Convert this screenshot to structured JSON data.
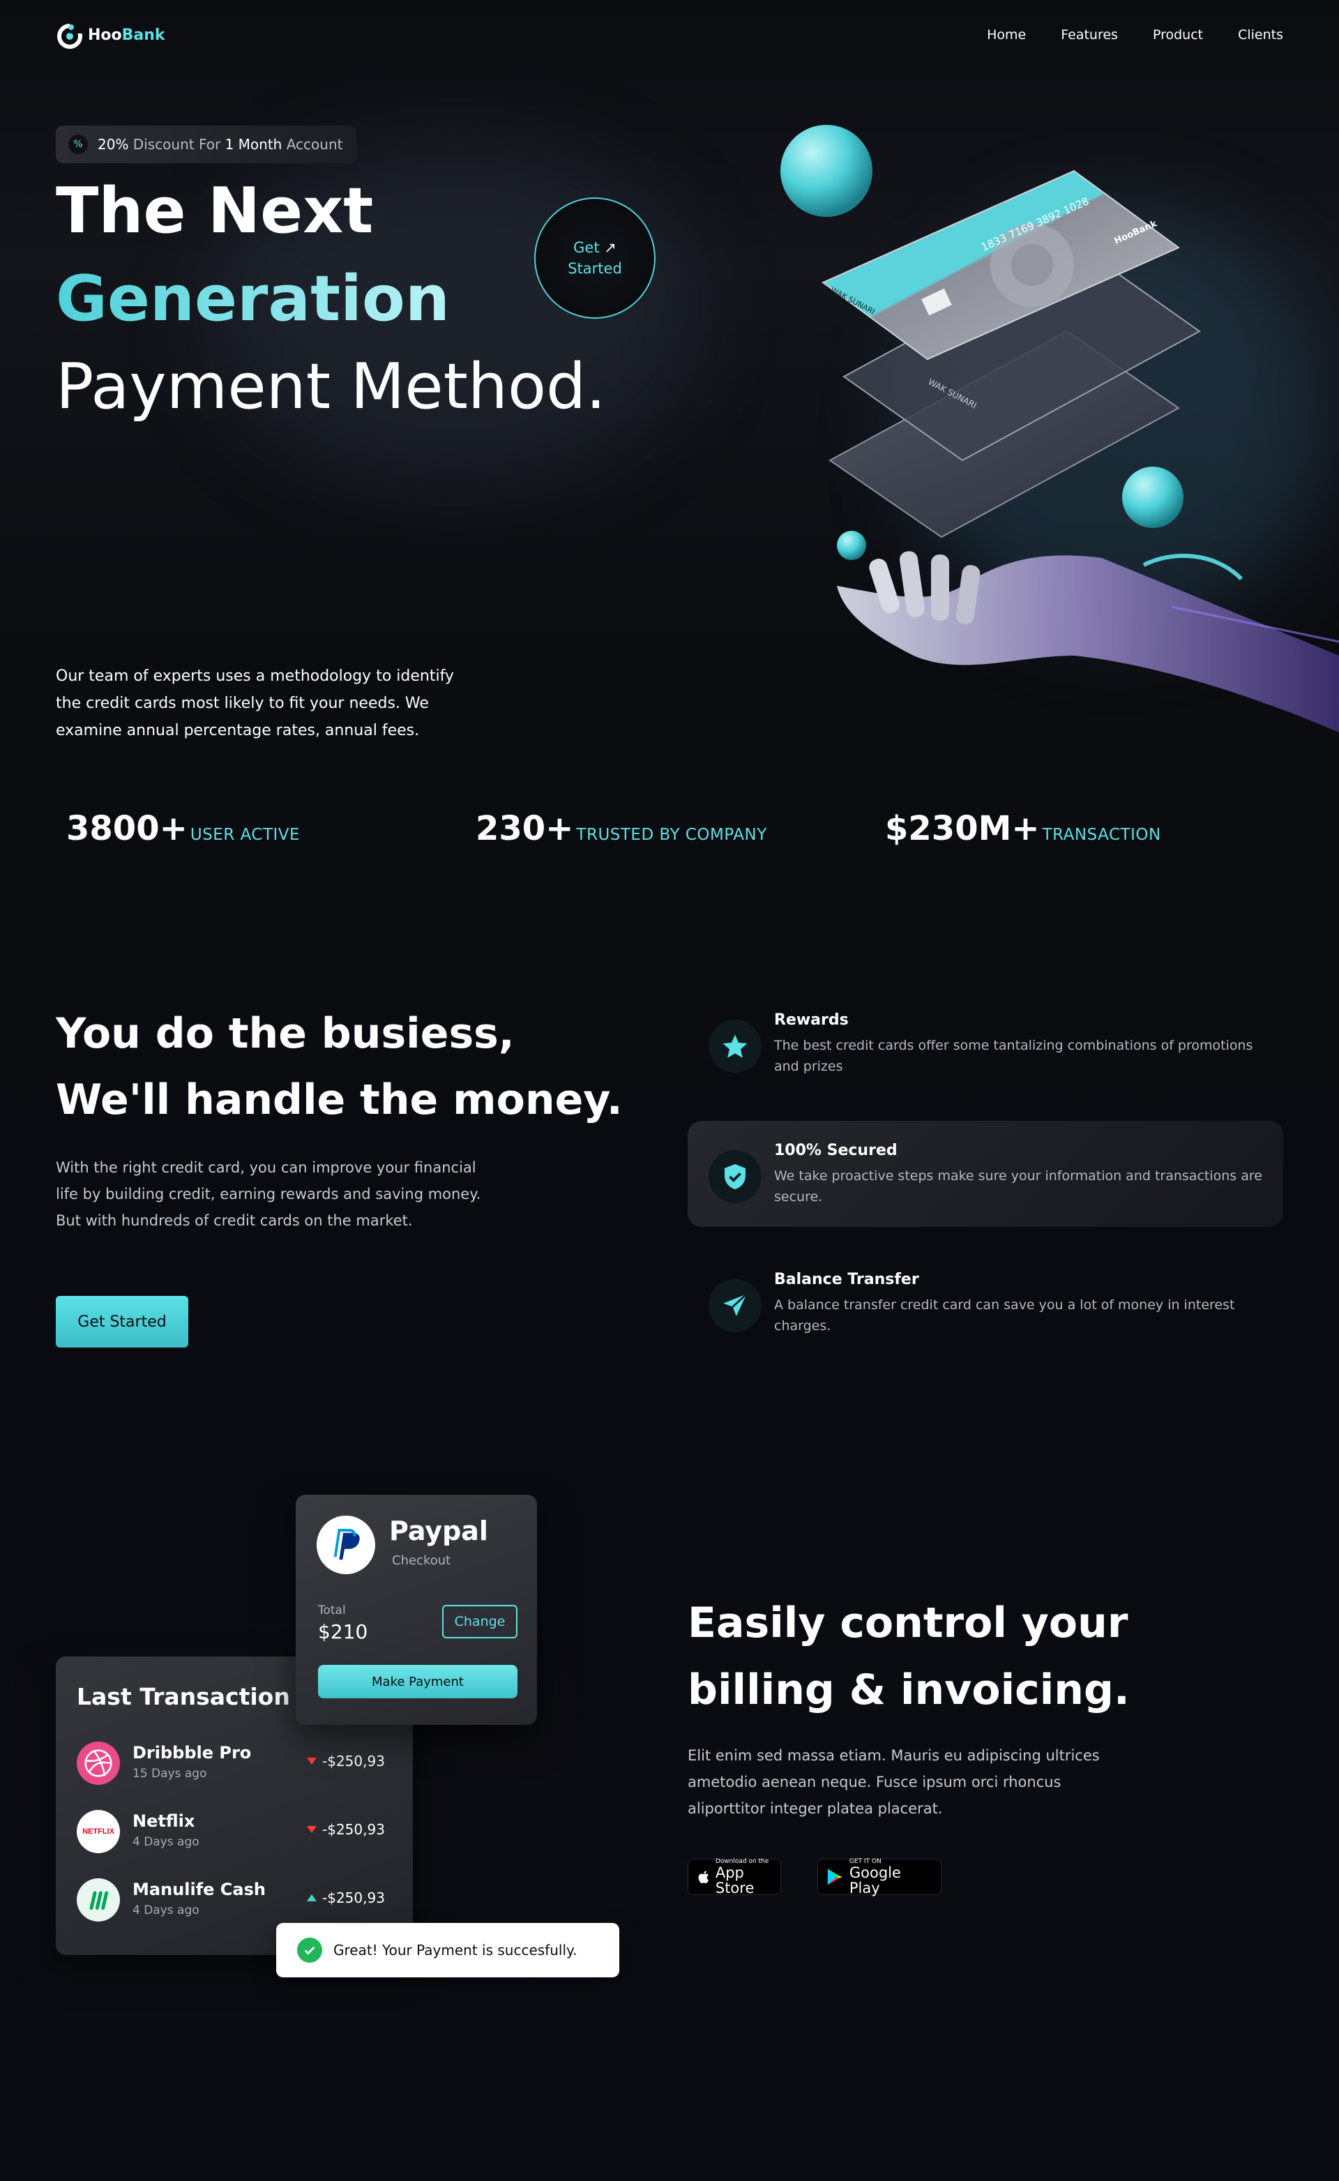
{
  "brand": {
    "name_part1": "Hoo",
    "name_part2": "Bank",
    "accent": "#5ce1e6"
  },
  "nav": {
    "items": [
      "Home",
      "Features",
      "Product",
      "Clients"
    ]
  },
  "hero": {
    "badge_icon": "percent-icon",
    "badge_pre": "20%",
    "badge_mid": " Discount For ",
    "badge_bold": "1 Month",
    "badge_post": " Account",
    "title_line1": "The Next",
    "title_line2": "Generation",
    "title_line3": "Payment Method.",
    "cta_line1": "Get",
    "cta_line2": "Started",
    "description": "Our team of experts uses a methodology to identify the credit cards most likely to fit your needs. We examine annual percentage rates, annual fees."
  },
  "card_art": {
    "number": "1833 7169 3892 1028",
    "holder": "WAK SUNARI",
    "brand": "HooBank"
  },
  "stats": [
    {
      "value": "3800+",
      "label": "USER ACTIVE"
    },
    {
      "value": "230+",
      "label": "TRUSTED BY COMPANY"
    },
    {
      "value": "$230M+",
      "label": "TRANSACTION"
    }
  ],
  "business": {
    "title_line1": "You do the busiess,",
    "title_line2": "We'll handle the money.",
    "description": "With the right credit card, you can improve your financial life by building credit, earning rewards and saving money. But with hundreds of credit cards on the market.",
    "cta": "Get Started",
    "features": [
      {
        "icon": "star-icon",
        "title": "Rewards",
        "text": "The best credit cards offer some tantalizing combinations of promotions and prizes"
      },
      {
        "icon": "shield-icon",
        "title": "100% Secured",
        "text": "We take proactive steps make sure your information and transactions are secure."
      },
      {
        "icon": "send-icon",
        "title": "Balance Transfer",
        "text": "A balance transfer credit card can save you a lot of money in interest charges."
      }
    ]
  },
  "billing": {
    "title_line1": "Easily control your",
    "title_line2": "billing & invoicing.",
    "description": "Elit enim sed massa etiam. Mauris eu adipiscing ultrices ametodio aenean neque. Fusce ipsum orci rhoncus aliporttitor integer platea placerat.",
    "stores": [
      {
        "icon": "apple-icon",
        "small": "Download on the",
        "big": "App Store"
      },
      {
        "icon": "google-play-icon",
        "small": "GET IT ON",
        "big": "Google Play"
      }
    ]
  },
  "paypal": {
    "name": "Paypal",
    "subtitle": "Checkout",
    "total_label": "Total",
    "total_value": "$210",
    "change": "Change",
    "pay": "Make Payment"
  },
  "last_transaction": {
    "title": "Last Transaction",
    "items": [
      {
        "name": "Dribbble Pro",
        "date": "15 Days ago",
        "amount": "-$250,93",
        "direction": "down",
        "icon": "dribbble-icon"
      },
      {
        "name": "Netflix",
        "date": "4 Days ago",
        "amount": "-$250,93",
        "direction": "down",
        "icon": "netflix-icon",
        "logo_text": "NETFLIX"
      },
      {
        "name": "Manulife Cash",
        "date": "4 Days ago",
        "amount": "-$250,93",
        "direction": "up",
        "icon": "manulife-icon"
      }
    ]
  },
  "toast": {
    "text": "Great! Your Payment is succesfully."
  }
}
